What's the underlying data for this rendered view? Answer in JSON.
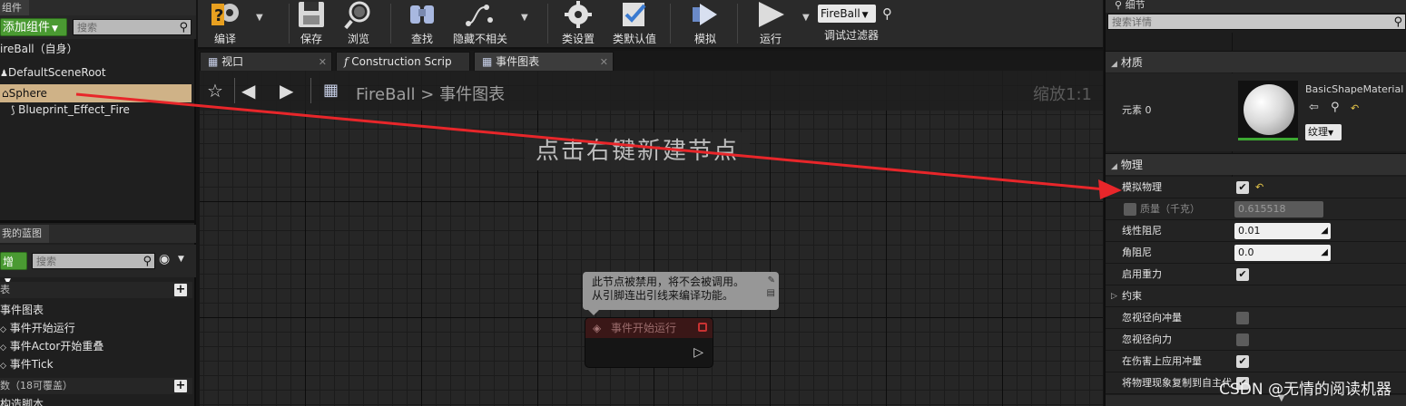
{
  "components_panel": {
    "tab_label": "组件",
    "add_button": "添加组件",
    "search_placeholder": "搜索",
    "self_label": "ireBall（自身）",
    "tree": [
      {
        "label": "DefaultSceneRoot",
        "selected": false
      },
      {
        "label": "Sphere",
        "selected": true
      },
      {
        "label": "Blueprint_Effect_Fire",
        "selected": false
      }
    ]
  },
  "my_blueprint": {
    "tab_label": "我的蓝图",
    "new_button": "增",
    "search_placeholder": "搜索",
    "section_graphs": "表",
    "graph_name": "事件图表",
    "events": [
      "事件开始运行",
      "事件Actor开始重叠",
      "事件Tick"
    ],
    "functions_header": "数（18可覆盖）",
    "construction_script": "构造脚本"
  },
  "toolbar": {
    "compile": "编译",
    "save": "保存",
    "browse": "浏览",
    "find": "查找",
    "hide_unrelated": "隐藏不相关",
    "class_settings": "类设置",
    "class_defaults": "类默认值",
    "simulate": "模拟",
    "play": "运行",
    "debug_object": "FireBall",
    "debug_filter": "调试过滤器"
  },
  "editor_tabs": [
    {
      "label": "视口",
      "icon": "viewport-icon"
    },
    {
      "label": "Construction Scrip",
      "icon": "function-icon"
    },
    {
      "label": "事件图表",
      "icon": "graph-icon"
    }
  ],
  "graph": {
    "breadcrumb_root": "FireBall",
    "breadcrumb_sep": ">",
    "breadcrumb_leaf": "事件图表",
    "zoom": "缩放1:1",
    "hint": "点击右键新建节点",
    "tooltip_line1": "此节点被禁用，将不会被调用。",
    "tooltip_line2": "从引脚连出引线来编译功能。",
    "node_title": "事件开始运行"
  },
  "details": {
    "tab_label": "细节",
    "search_placeholder": "搜索详情",
    "materials_section": "材质",
    "element_label": "元素 0",
    "material_name": "BasicShapeMaterial",
    "texture_button": "纹理",
    "physics_section": "物理",
    "simulate_physics": "模拟物理",
    "mass_label": "质量（千克）",
    "mass_value": "0.615518",
    "linear_damping": "线性阻尼",
    "linear_damping_value": "0.01",
    "angular_damping": "角阻尼",
    "angular_damping_value": "0.0",
    "enable_gravity": "启用重力",
    "constraints": "约束",
    "ignore_radial_impulse": "忽视径向冲量",
    "ignore_radial_force": "忽视径向力",
    "apply_impulse_on_damage": "在伤害上应用冲量",
    "replicate_physics": "将物理现象复制到自主代"
  },
  "watermark": "CSDN @无情的阅读机器",
  "colors": {
    "selection": "#cfb287",
    "accent_green": "#4a9a32",
    "arrow_red": "#e8262a"
  }
}
